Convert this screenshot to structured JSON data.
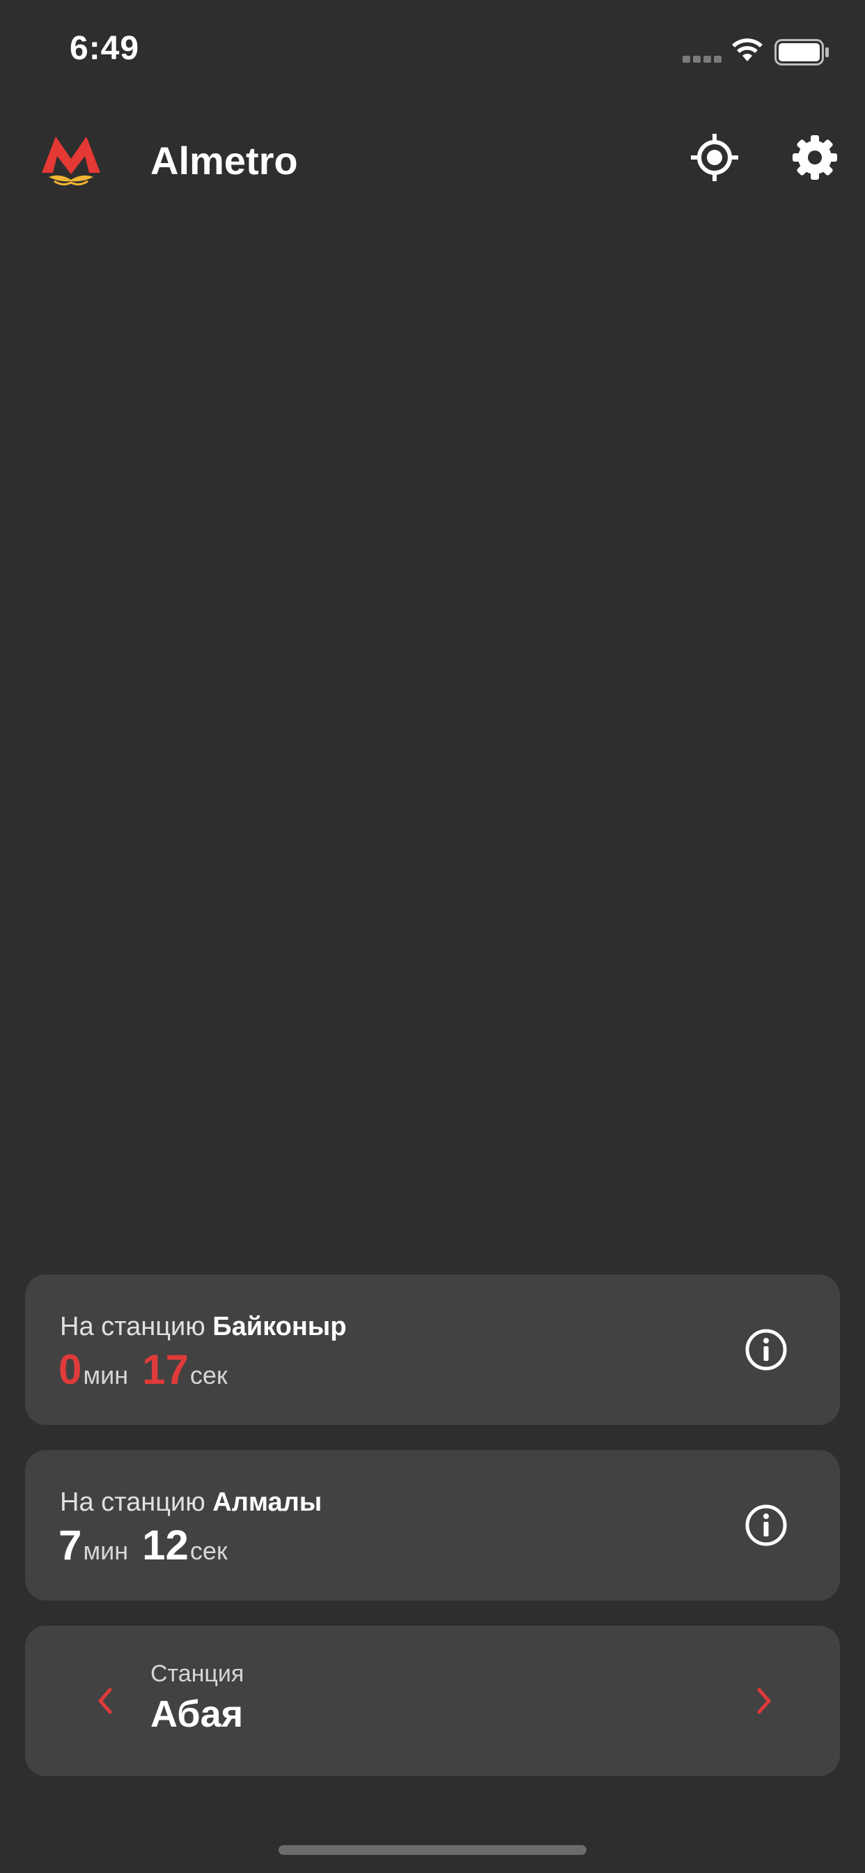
{
  "status_bar": {
    "time": "6:49",
    "icons": [
      "cellular-signal-icon",
      "wifi-icon",
      "battery-icon"
    ]
  },
  "header": {
    "title": "Almetro",
    "logo_icon": "metro-logo-icon",
    "locate_icon": "locate-crosshair-icon",
    "settings_icon": "gear-icon"
  },
  "colors": {
    "background": "#2e2e2e",
    "card": "#424242",
    "accent_red": "#e03a3a"
  },
  "arrivals": [
    {
      "prefix": "На станцию",
      "station": "Байконыр",
      "minutes": "0",
      "min_unit": "мин",
      "seconds": "17",
      "sec_unit": "сек",
      "highlight": true
    },
    {
      "prefix": "На станцию",
      "station": "Алмалы",
      "minutes": "7",
      "min_unit": "мин",
      "seconds": "12",
      "sec_unit": "сек",
      "highlight": false
    }
  ],
  "station_selector": {
    "label": "Станция",
    "name": "Абая"
  }
}
